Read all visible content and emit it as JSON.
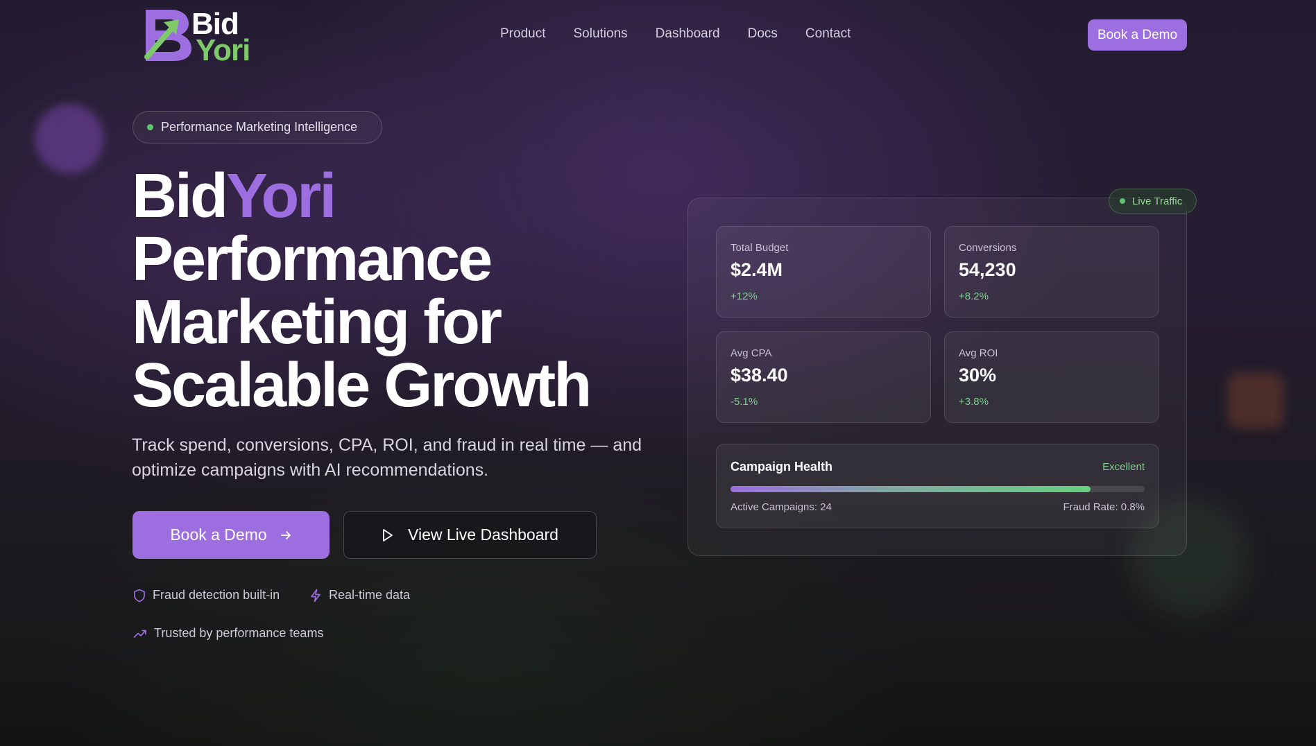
{
  "brand": {
    "logo_line1": "Bid",
    "logo_line2": "Yori",
    "accent_color": "#9c6ee0",
    "green_color": "#7ec96a"
  },
  "nav": {
    "links": [
      "Product",
      "Solutions",
      "Dashboard",
      "Docs",
      "Contact"
    ],
    "cta_label": "Book a Demo"
  },
  "hero": {
    "badge_text": "Performance Marketing Intelligence",
    "title_part1": "Bid",
    "title_accent": "Yori",
    "title_line2": "Performance",
    "title_line3": "Marketing for",
    "title_line4": "Scalable Growth",
    "subtitle": "Track spend, conversions, CPA, ROI, and fraud in real time — and optimize campaigns with AI recommendations.",
    "primary_button": "Book a Demo",
    "primary_button_icon": "arrow-right-icon",
    "secondary_button": "View Live Dashboard",
    "secondary_button_icon": "play-icon",
    "features": [
      {
        "label": "Fraud detection built-in",
        "icon": "shield-icon"
      },
      {
        "label": "Real-time data",
        "icon": "lightning-icon"
      },
      {
        "label": "Trusted by performance teams",
        "icon": "trending-up-icon"
      }
    ]
  },
  "dashboard": {
    "live_label": "Live Traffic",
    "stats": [
      {
        "label": "Total Budget",
        "value": "$2.4M",
        "change": "+12%"
      },
      {
        "label": "Conversions",
        "value": "54,230",
        "change": "+8.2%"
      },
      {
        "label": "Avg CPA",
        "value": "$38.40",
        "change": "-5.1%"
      },
      {
        "label": "Avg ROI",
        "value": "30%",
        "change": "+3.8%"
      }
    ],
    "health": {
      "title": "Campaign Health",
      "status": "Excellent",
      "progress_percent": 87,
      "active_campaigns": "Active Campaigns: 24",
      "fraud_rate": "Fraud Rate: 0.8%"
    }
  }
}
